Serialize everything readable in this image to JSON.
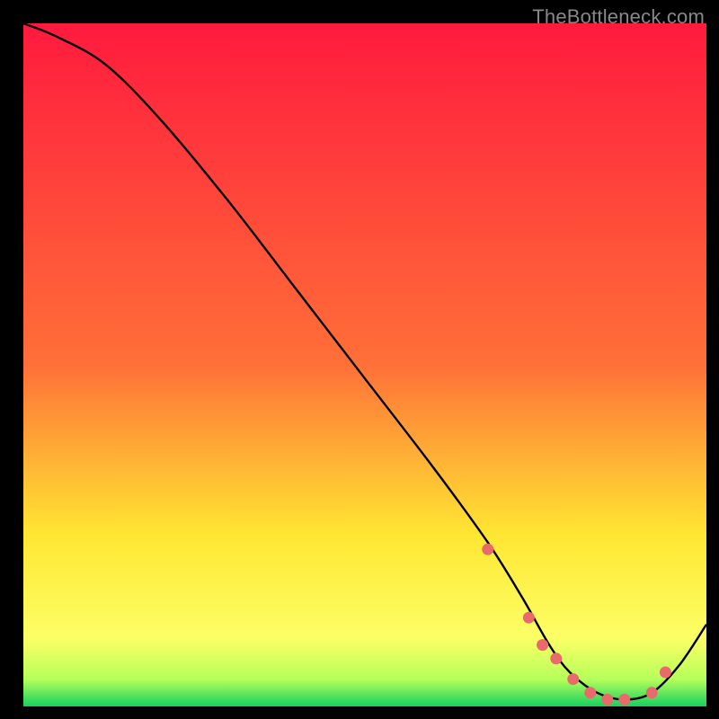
{
  "watermark": "TheBottleneck.com",
  "chart_data": {
    "type": "line",
    "title": "",
    "xlabel": "",
    "ylabel": "",
    "xlim": [
      0,
      100
    ],
    "ylim": [
      0,
      100
    ],
    "gradient_bands": [
      {
        "y0": 0,
        "y1": 50,
        "c0": "#ff1a3e",
        "c1": "#ff7038"
      },
      {
        "y0": 50,
        "y1": 75,
        "c0": "#ff7038",
        "c1": "#ffe733"
      },
      {
        "y0": 75,
        "y1": 90,
        "c0": "#ffe733",
        "c1": "#fcff66"
      },
      {
        "y0": 90,
        "y1": 96,
        "c0": "#fcff66",
        "c1": "#b6ff5a"
      },
      {
        "y0": 96,
        "y1": 100,
        "c0": "#b6ff5a",
        "c1": "#17d05f"
      }
    ],
    "series": [
      {
        "name": "bottleneck-curve",
        "x": [
          0,
          5,
          12,
          20,
          30,
          40,
          50,
          60,
          68,
          73,
          77,
          80,
          84,
          88,
          92,
          96,
          100
        ],
        "y": [
          100,
          98,
          94,
          86,
          74,
          61,
          48,
          35,
          24,
          16,
          9,
          5,
          2,
          1,
          2,
          6,
          12
        ]
      }
    ],
    "markers": {
      "name": "highlight-dots",
      "color": "#e86a6a",
      "x": [
        68,
        74,
        76,
        78,
        80.5,
        83,
        85.5,
        88,
        92,
        94
      ],
      "y": [
        23,
        13,
        9,
        7,
        4,
        2,
        1,
        1,
        2,
        5
      ]
    }
  }
}
